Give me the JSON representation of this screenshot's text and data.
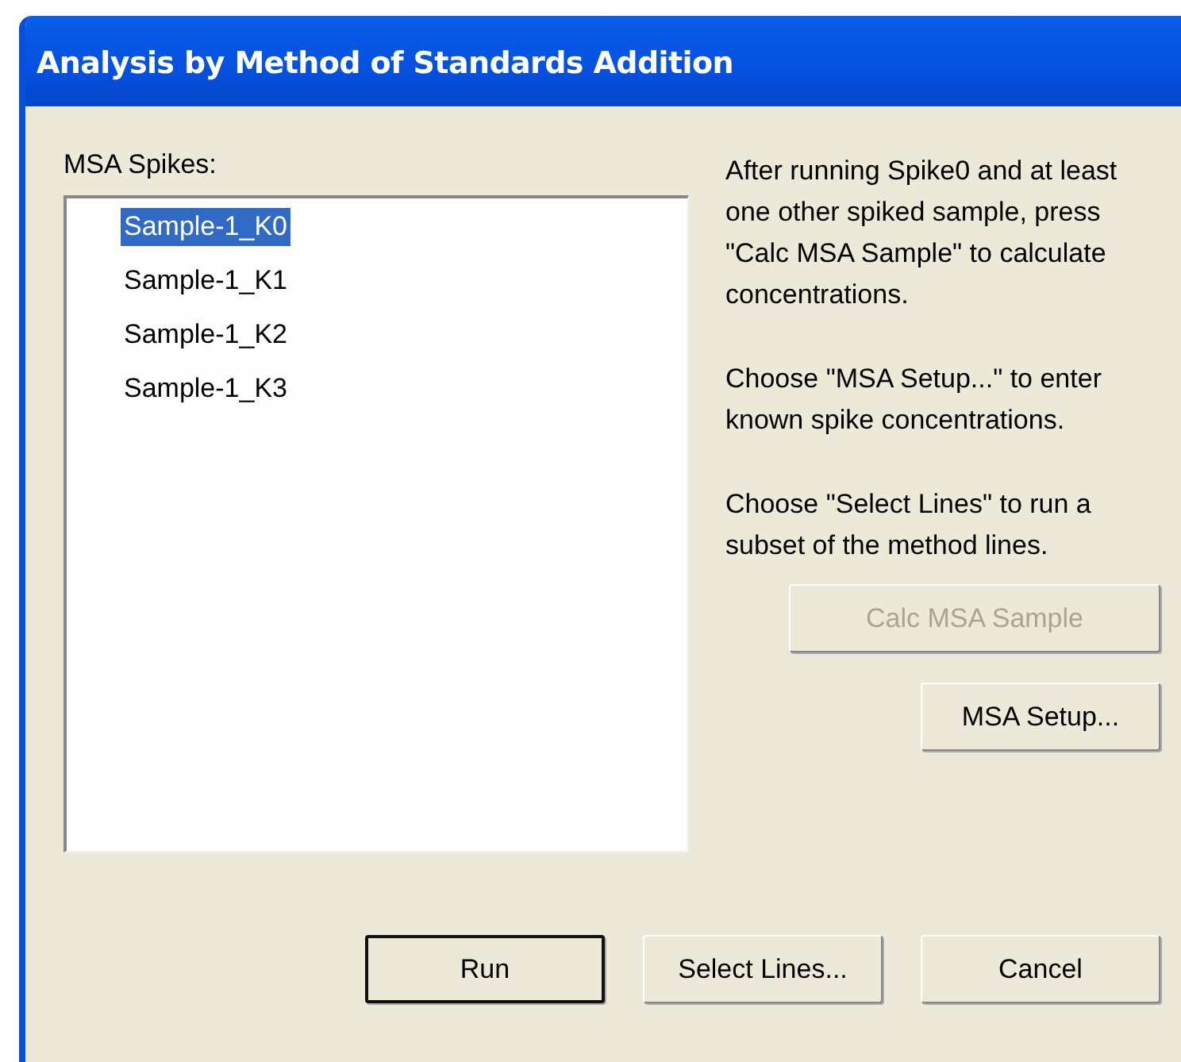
{
  "window": {
    "title": "Analysis by Method of Standards Addition"
  },
  "list": {
    "label": "MSA Spikes:",
    "items": [
      {
        "text": "Sample-1_K0",
        "selected": true
      },
      {
        "text": "Sample-1_K1",
        "selected": false
      },
      {
        "text": "Sample-1_K2",
        "selected": false
      },
      {
        "text": "Sample-1_K3",
        "selected": false
      }
    ]
  },
  "help": [
    "After running Spike0 and at least one other spiked sample, press \"Calc MSA Sample\" to calculate concentrations.",
    "Choose \"MSA Setup...\" to enter known spike concentrations.",
    "Choose \"Select Lines\" to run a subset of the method lines."
  ],
  "side_buttons": [
    {
      "label": "Calc MSA Sample",
      "disabled": true
    },
    {
      "label": "MSA Setup...",
      "disabled": false
    }
  ],
  "buttons": [
    {
      "label": "Run",
      "default": true
    },
    {
      "label": "Select Lines...",
      "default": false
    },
    {
      "label": "Cancel",
      "default": false
    }
  ]
}
